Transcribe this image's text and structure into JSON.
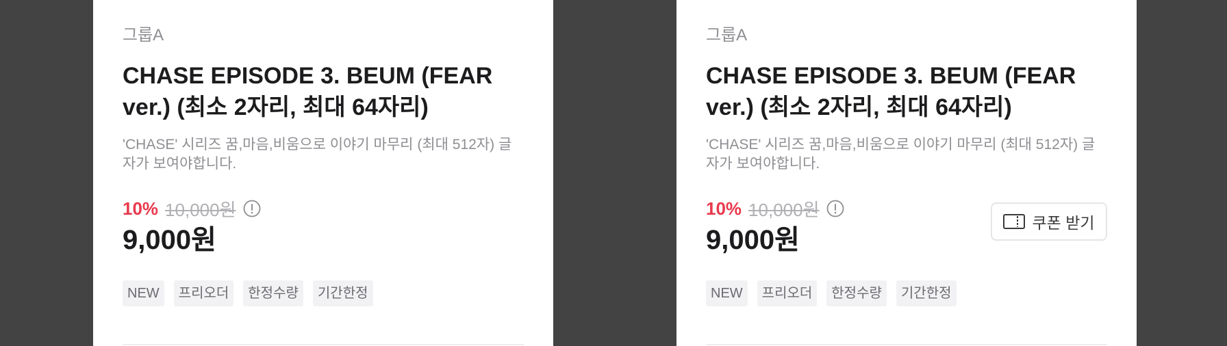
{
  "cards": [
    {
      "group": "그룹A",
      "title": "CHASE EPISODE 3. BEUM (FEAR ver.) (최소 2자리, 최대 64자리)",
      "description": "'CHASE' 시리즈 꿈,마음,비움으로 이야기 마무리 (최대 512자) 글자가 보여야합니다.",
      "discount_rate": "10%",
      "original_price": "10,000원",
      "final_price": "9,000원",
      "info_icon": "info-circle-icon",
      "tags": [
        "NEW",
        "프리오더",
        "한정수량",
        "기간한정"
      ]
    },
    {
      "group": "그룹A",
      "title": "CHASE EPISODE 3. BEUM (FEAR ver.) (최소 2자리, 최대 64자리)",
      "description": "'CHASE' 시리즈 꿈,마음,비움으로 이야기 마무리 (최대 512자) 글자가 보여야합니다.",
      "discount_rate": "10%",
      "original_price": "10,000원",
      "final_price": "9,000원",
      "info_icon": "info-circle-icon",
      "coupon_label": "쿠폰 받기",
      "coupon_icon": "coupon-ticket-icon",
      "tags": [
        "NEW",
        "프리오더",
        "한정수량",
        "기간한정"
      ]
    }
  ],
  "colors": {
    "background": "#434343",
    "discount": "#e8394d",
    "text_primary": "#1c1c1e",
    "text_secondary": "#8e8e93"
  }
}
